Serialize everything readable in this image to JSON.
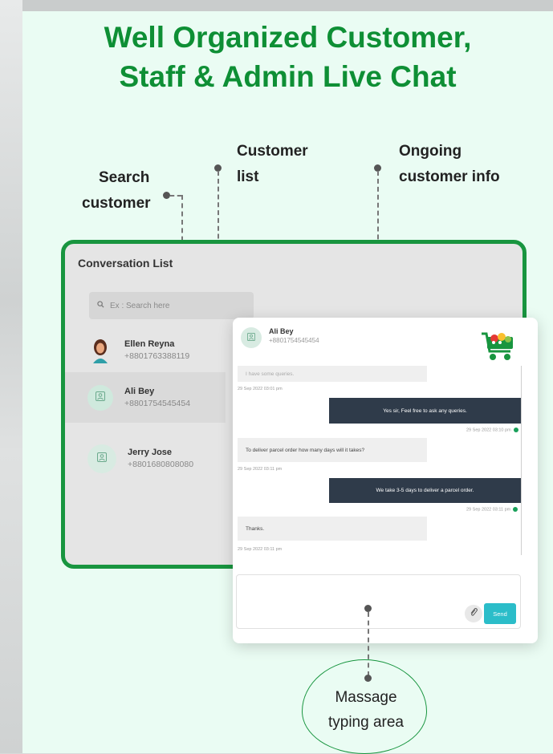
{
  "headline": {
    "line1": "Well Organized Customer,",
    "line2": "Staff & Admin Live Chat"
  },
  "callouts": {
    "search_line1": "Search",
    "search_line2": "customer",
    "list_line1": "Customer",
    "list_line2": "list",
    "ongoing_line1": "Ongoing",
    "ongoing_line2": "customer info",
    "typing_line1": "Massage",
    "typing_line2": "typing area"
  },
  "conversation": {
    "title": "Conversation List",
    "search_placeholder": "Ex : Search here",
    "customers": [
      {
        "name": "Ellen Reyna",
        "phone": "+8801763388119"
      },
      {
        "name": "Ali Bey",
        "phone": "+8801754545454"
      },
      {
        "name": "Jerry Jose",
        "phone": "+8801680808080"
      }
    ]
  },
  "chat": {
    "header_name": "Ali Bey",
    "header_phone": "+8801754545454",
    "messages": [
      {
        "dir": "in",
        "text": "I have some queries."
      },
      {
        "dir": "ts",
        "text": "29 Sep 2022 03:01 pm"
      },
      {
        "dir": "out",
        "text": "Yes sir, Feel free to ask any queries."
      },
      {
        "dir": "ts",
        "text": "29 Sep 2022 03:10 pm"
      },
      {
        "dir": "in",
        "text": "To deliver parcel order how many days will it takes?"
      },
      {
        "dir": "ts",
        "text": "29 Sep 2022 03:11 pm"
      },
      {
        "dir": "out",
        "text": "We take 3-5 days to deliver a parcel order."
      },
      {
        "dir": "ts",
        "text": "29 Sep 2022 03:11 pm"
      },
      {
        "dir": "in",
        "text": "Thanks."
      },
      {
        "dir": "ts",
        "text": "29 Sep 2022 03:11 pm"
      }
    ],
    "send_label": "Send"
  },
  "colors": {
    "brand_green": "#0e8f35",
    "border_green": "#18953f",
    "send_button": "#2bbdc9",
    "outgoing_bubble": "#2f3b4a"
  },
  "icons": [
    "search-icon",
    "user-placeholder-icon",
    "paperclip-icon",
    "grocery-cart-logo"
  ]
}
